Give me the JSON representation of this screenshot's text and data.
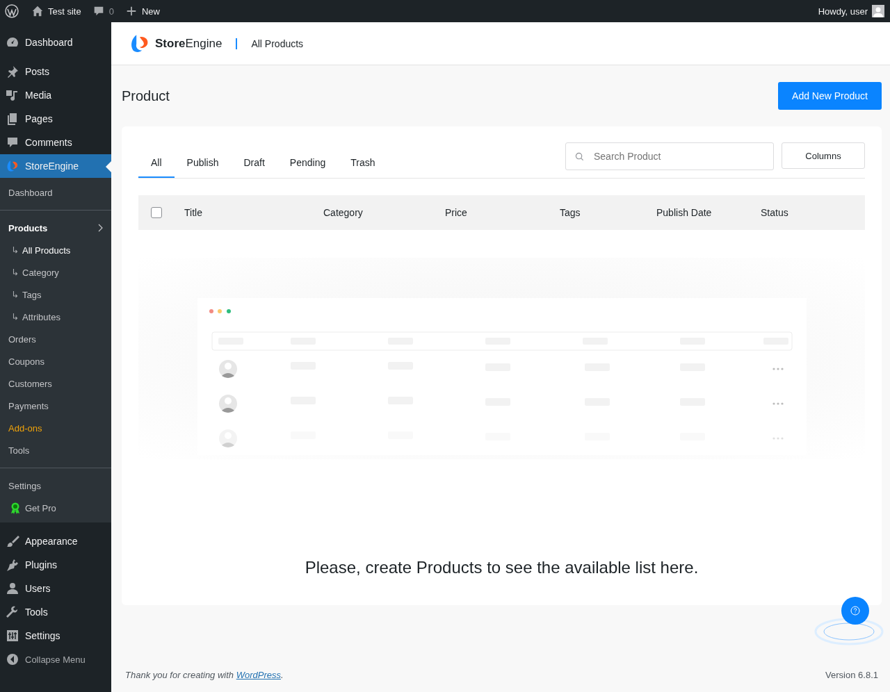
{
  "admin_bar": {
    "site_name": "Test site",
    "comments_count": "0",
    "new_label": "New",
    "greeting": "Howdy, user"
  },
  "sidebar": {
    "top_items": [
      {
        "label": "Dashboard",
        "kind": "gauge",
        "selected": false
      },
      {
        "label": "Posts",
        "kind": "pin",
        "selected": false
      },
      {
        "label": "Media",
        "kind": "media",
        "selected": false
      },
      {
        "label": "Pages",
        "kind": "pages",
        "selected": false
      },
      {
        "label": "Comments",
        "kind": "comment",
        "selected": false
      },
      {
        "label": "StoreEngine",
        "kind": "logo",
        "selected": true
      }
    ],
    "submenu_groups": [
      [
        {
          "label": "Dashboard",
          "kind": "link",
          "selected": false
        }
      ],
      [
        {
          "label": "Products",
          "kind": "parent",
          "selected": false
        },
        {
          "label": "All Products",
          "kind": "child",
          "selected": true
        },
        {
          "label": "Category",
          "kind": "child",
          "selected": false
        },
        {
          "label": "Tags",
          "kind": "child",
          "selected": false
        },
        {
          "label": "Attributes",
          "kind": "child",
          "selected": false
        },
        {
          "label": "Orders",
          "kind": "link",
          "selected": false
        },
        {
          "label": "Coupons",
          "kind": "link",
          "selected": false
        },
        {
          "label": "Customers",
          "kind": "link",
          "selected": false
        },
        {
          "label": "Payments",
          "kind": "link",
          "selected": false
        },
        {
          "label": "Add-ons",
          "kind": "accent",
          "selected": false
        },
        {
          "label": "Tools",
          "kind": "link",
          "selected": false
        }
      ],
      [
        {
          "label": "Settings",
          "kind": "link",
          "selected": false
        },
        {
          "label": "Get Pro",
          "kind": "pro",
          "selected": false
        }
      ]
    ],
    "bottom_items": [
      {
        "label": "Appearance",
        "kind": "brush",
        "selected": false
      },
      {
        "label": "Plugins",
        "kind": "plug",
        "selected": false
      },
      {
        "label": "Users",
        "kind": "user",
        "selected": false
      },
      {
        "label": "Tools",
        "kind": "wrench",
        "selected": false
      },
      {
        "label": "Settings",
        "kind": "sliders",
        "selected": false
      },
      {
        "label": "Collapse Menu",
        "kind": "collapse",
        "selected": false
      }
    ]
  },
  "header": {
    "brand": "**Store**Engine",
    "breadcrumb": "All Products"
  },
  "page": {
    "title": "Product",
    "add_button": "Add New Product"
  },
  "tabs": [
    {
      "label": "All",
      "selected": true
    },
    {
      "label": "Publish",
      "selected": false
    },
    {
      "label": "Draft",
      "selected": false
    },
    {
      "label": "Pending",
      "selected": false
    },
    {
      "label": "Trash",
      "selected": false
    }
  ],
  "search": {
    "placeholder": "Search Product"
  },
  "columns_button": "Columns",
  "table": {
    "select_all_checked": false,
    "columns": [
      "Title",
      "Category",
      "Price",
      "Tags",
      "Publish Date",
      "Status"
    ]
  },
  "empty_message": "Please, create Products to see the available list here.",
  "footer": {
    "text_before": "Thank you for creating with ",
    "link": "WordPress",
    "text_after": ".",
    "version": "Version 6.8.1"
  }
}
